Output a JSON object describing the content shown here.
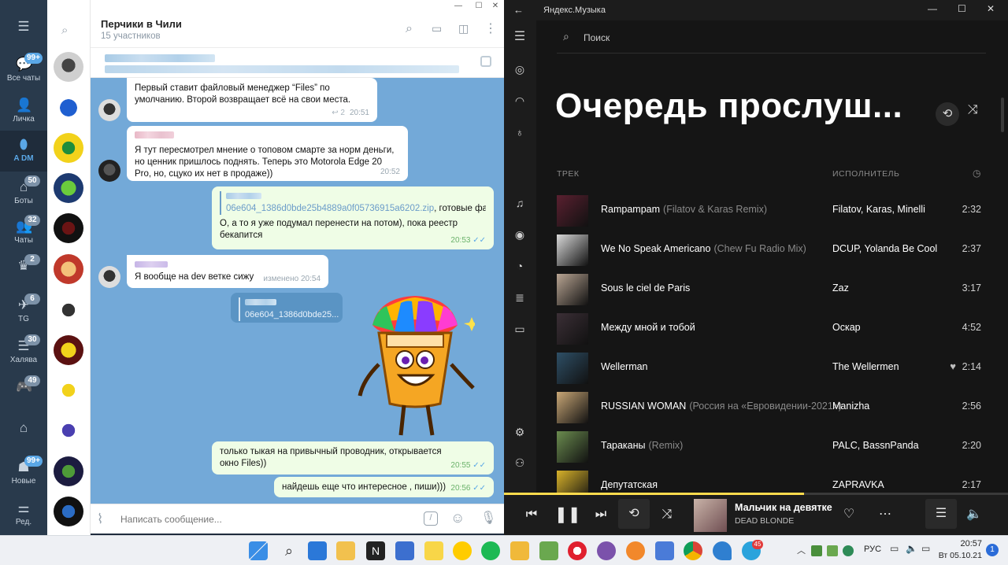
{
  "telegram": {
    "folders": [
      {
        "label": "Все чаты",
        "badge": "99+",
        "icon": "chats-icon",
        "badge_style": "blue"
      },
      {
        "label": "Личка",
        "badge": "",
        "icon": "person-icon"
      },
      {
        "label": "A DM",
        "badge": "",
        "icon": "mask-icon",
        "active": true
      },
      {
        "label": "Боты",
        "badge": "50",
        "icon": "bot-icon"
      },
      {
        "label": "Чаты",
        "badge": "32",
        "icon": "group-icon"
      },
      {
        "label": "",
        "badge": "2",
        "icon": "crown-icon"
      },
      {
        "label": "TG",
        "badge": "6",
        "icon": "telegram-icon"
      },
      {
        "label": "Халява",
        "badge": "30",
        "icon": "gift-icon"
      },
      {
        "label": "",
        "badge": "49",
        "icon": "gamepad-icon"
      },
      {
        "label": "",
        "badge": "",
        "icon": "home-icon"
      },
      {
        "label": "Новые",
        "badge": "99+",
        "icon": "new-icon",
        "badge_style": "blue"
      },
      {
        "label": "Ред.",
        "badge": "",
        "icon": "settings-sliders-icon"
      }
    ],
    "chat": {
      "title": "Перчики в Чили",
      "subtitle": "15 участников"
    },
    "messages": [
      {
        "text": "Первый ставит файловый менеджер “Files” по умолчанию. Второй возвращает всё на свои места.",
        "time": "20:51",
        "meta": "2"
      },
      {
        "text": "Я тут пересмотрел мнение о топовом смарте за норм деньги, но ценник пришлось поднять. Теперь это Motorola Edge 20 Pro, но, сцуко их нет в продаже))",
        "time": "20:52"
      },
      {
        "file": "06e604_1386d0bde25b4889a0f05736915a6202.zip",
        "file_suffix": ", готовые фай...",
        "text": "О, а то я уже подумал перенести на потом), пока реестр бекапится",
        "time": "20:53"
      },
      {
        "text": "Я вообще на dev ветке сижу",
        "time": "изменено 20:54"
      },
      {
        "file": "06e604_1386d0bde25..."
      },
      {
        "text": "только тыкая на привычный проводник, открывается окно Files))",
        "time": "20:55"
      },
      {
        "text": "найдешь еще что интересное , пиши)))",
        "time": "20:56"
      }
    ],
    "input_placeholder": "Написать сообщение..."
  },
  "music": {
    "app_title": "Яндекс.Музыка",
    "search_placeholder": "Поиск",
    "page_title": "Очередь прослуш...",
    "columns": {
      "track": "ТРЕК",
      "artist": "ИСПОЛНИТЕЛЬ"
    },
    "tracks": [
      {
        "name": "Rampampam",
        "version": "(Filatov & Karas Remix)",
        "artist": "Filatov, Karas, Minelli",
        "duration": "2:32",
        "liked": false,
        "cover": "#5a2030"
      },
      {
        "name": "We No Speak Americano",
        "version": "(Chew Fu Radio Mix)",
        "artist": "DCUP, Yolanda Be Cool",
        "duration": "2:37",
        "liked": false,
        "cover": "#d9d9d9"
      },
      {
        "name": "Sous le ciel de Paris",
        "version": "",
        "artist": "Zaz",
        "duration": "3:17",
        "liked": false,
        "cover": "#b9a593"
      },
      {
        "name": "Между мной и тобой",
        "version": "",
        "artist": "Оскар",
        "duration": "4:52",
        "liked": false,
        "cover": "#3b2f36"
      },
      {
        "name": "Wellerman",
        "version": "",
        "artist": "The Wellermen",
        "duration": "2:14",
        "liked": true,
        "cover": "#2e4f66"
      },
      {
        "name": "RUSSIAN WOMAN",
        "version": "(Россия на «Евровидении-2021»)",
        "artist": "Manizha",
        "duration": "2:56",
        "liked": false,
        "cover": "#c9a776"
      },
      {
        "name": "Тараканы",
        "version": "(Remix)",
        "artist": "PALC, BassnPanda",
        "duration": "2:20",
        "liked": false,
        "cover": "#6b8c4f"
      },
      {
        "name": "Депутатская",
        "version": "",
        "artist": "ZAPRAVKA",
        "duration": "2:17",
        "liked": false,
        "cover": "#d8b22a"
      }
    ],
    "now_playing": {
      "title": "Мальчик на девятке",
      "artist": "DEAD BLONDE",
      "progress": 0.595
    }
  },
  "taskbar": {
    "lang": "РУС",
    "time": "20:57",
    "date": "Вт 05.10.21",
    "notifications": "1",
    "telegram_badge": "45"
  },
  "colors": {
    "tg_accent": "#5aa7e6",
    "ym_accent": "#ffdb4d"
  }
}
